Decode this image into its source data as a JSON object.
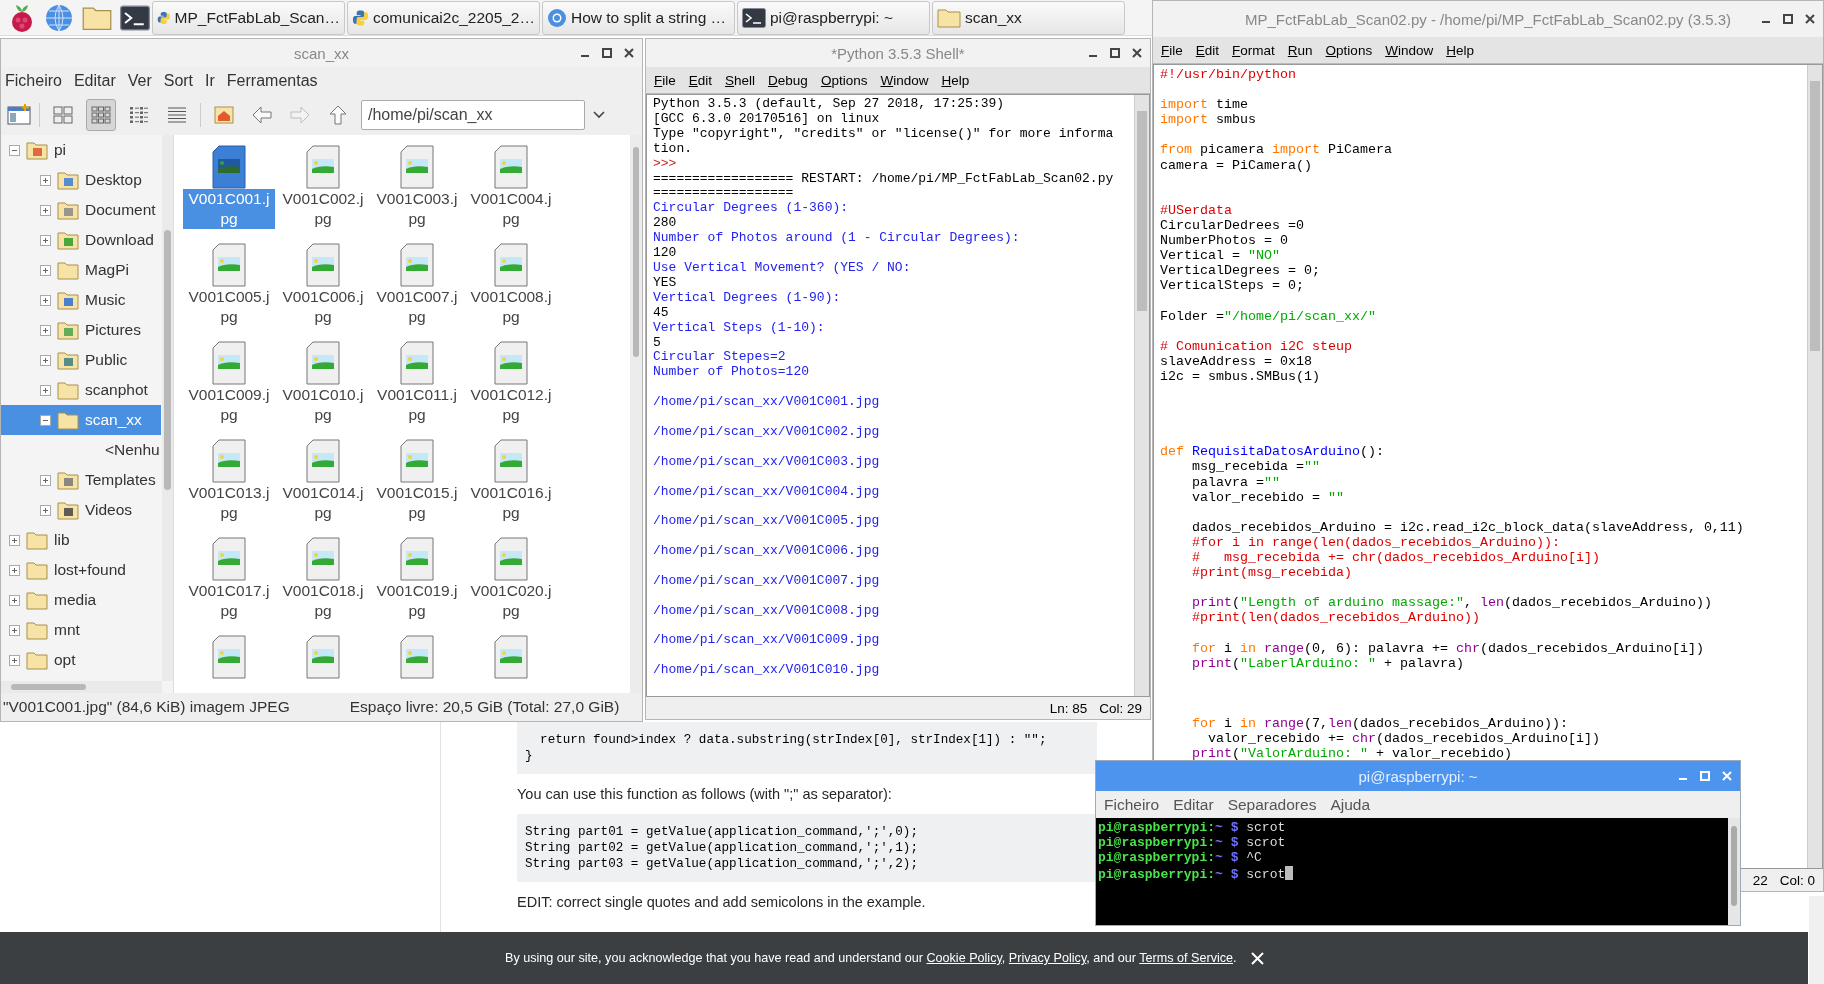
{
  "taskbar": {
    "tasks": [
      {
        "label": "MP_FctFabLab_Scan…",
        "kind": "python"
      },
      {
        "label": "comunicai2c_2205_2…",
        "kind": "python"
      },
      {
        "label": "How to split a string …",
        "kind": "chromium"
      },
      {
        "label": "pi@raspberrypi: ~",
        "kind": "terminal"
      },
      {
        "label": "scan_xx",
        "kind": "folder"
      }
    ]
  },
  "browser": {
    "code_1": [
      "  return found>index ? data.substring(strIndex[0], strIndex[1]) : \"\";",
      "}"
    ],
    "paragraph": "You can use this function as follows (with \";\" as separator):",
    "code_2": [
      "String part01 = getValue(application_command,';',0);",
      "String part02 = getValue(application_command,';',1);",
      "String part03 = getValue(application_command,';',2);"
    ],
    "edit_note": "EDIT: correct single quotes and add semicolons in the example."
  },
  "cookie_banner": {
    "segments": [
      {
        "kind": "text",
        "text": "By using our site, you acknowledge that you have read and understand our "
      },
      {
        "kind": "link",
        "text": "Cookie Policy"
      },
      {
        "kind": "text",
        "text": ", "
      },
      {
        "kind": "link",
        "text": "Privacy Policy"
      },
      {
        "kind": "text",
        "text": ", and our "
      },
      {
        "kind": "link",
        "text": "Terms of Service"
      },
      {
        "kind": "text",
        "text": "."
      }
    ]
  },
  "file_manager": {
    "title": "scan_xx",
    "menu": [
      "Ficheiro",
      "Editar",
      "Ver",
      "Sort",
      "Ir",
      "Ferramentas"
    ],
    "views": [
      {
        "kind": "thumbnail",
        "selected": false
      },
      {
        "kind": "icon",
        "selected": true
      },
      {
        "kind": "compact",
        "selected": false
      },
      {
        "kind": "list",
        "selected": false
      }
    ],
    "nav": [
      {
        "kind": "home",
        "disabled": false
      },
      {
        "kind": "back",
        "disabled": false
      },
      {
        "kind": "forward",
        "disabled": true
      },
      {
        "kind": "up",
        "disabled": false
      }
    ],
    "path": "/home/pi/scan_xx",
    "tree": [
      {
        "label": "pi",
        "kind": "home",
        "expanded": true,
        "selected": false,
        "children": [
          {
            "label": "Desktop",
            "kind": "desktop",
            "expanded": false,
            "selected": false
          },
          {
            "label": "Document",
            "kind": "documents",
            "expanded": false,
            "selected": false
          },
          {
            "label": "Download",
            "kind": "download",
            "expanded": false,
            "selected": false
          },
          {
            "label": "MagPi",
            "kind": "plain",
            "expanded": false,
            "selected": false
          },
          {
            "label": "Music",
            "kind": "music",
            "expanded": false,
            "selected": false
          },
          {
            "label": "Pictures",
            "kind": "pictures",
            "expanded": false,
            "selected": false
          },
          {
            "label": "Public",
            "kind": "public",
            "expanded": false,
            "selected": false
          },
          {
            "label": "scanphot",
            "kind": "plain",
            "expanded": false,
            "selected": false
          },
          {
            "label": "scan_xx",
            "kind": "plain",
            "expanded": true,
            "selected": true,
            "children": [
              {
                "label": "<Nenhu",
                "kind": "placeholder",
                "selected": false
              }
            ]
          },
          {
            "label": "Templates",
            "kind": "templates",
            "expanded": false,
            "selected": false
          },
          {
            "label": "Videos",
            "kind": "videos",
            "expanded": false,
            "selected": false
          }
        ]
      },
      {
        "label": "lib",
        "kind": "plain",
        "expanded": false,
        "selected": false
      },
      {
        "label": "lost+found",
        "kind": "plain",
        "expanded": false,
        "selected": false
      },
      {
        "label": "media",
        "kind": "plain",
        "expanded": false,
        "selected": false
      },
      {
        "label": "mnt",
        "kind": "plain",
        "expanded": false,
        "selected": false
      },
      {
        "label": "opt",
        "kind": "plain",
        "expanded": false,
        "selected": false
      }
    ],
    "files": [
      {
        "name": "V001C001.jpg",
        "selected": true
      },
      {
        "name": "V001C002.jpg",
        "selected": false
      },
      {
        "name": "V001C003.jpg",
        "selected": false
      },
      {
        "name": "V001C004.jpg",
        "selected": false
      },
      {
        "name": "V001C005.jpg",
        "selected": false
      },
      {
        "name": "V001C006.jpg",
        "selected": false
      },
      {
        "name": "V001C007.jpg",
        "selected": false
      },
      {
        "name": "V001C008.jpg",
        "selected": false
      },
      {
        "name": "V001C009.jpg",
        "selected": false
      },
      {
        "name": "V001C010.jpg",
        "selected": false
      },
      {
        "name": "V001C011.jpg",
        "selected": false
      },
      {
        "name": "V001C012.jpg",
        "selected": false
      },
      {
        "name": "V001C013.jpg",
        "selected": false
      },
      {
        "name": "V001C014.jpg",
        "selected": false
      },
      {
        "name": "V001C015.jpg",
        "selected": false
      },
      {
        "name": "V001C016.jpg",
        "selected": false
      },
      {
        "name": "V001C017.jpg",
        "selected": false
      },
      {
        "name": "V001C018.jpg",
        "selected": false
      },
      {
        "name": "V001C019.jpg",
        "selected": false
      },
      {
        "name": "V001C020.jpg",
        "selected": false
      },
      {
        "selected": false
      },
      {
        "selected": false
      },
      {
        "selected": false
      },
      {
        "selected": false
      }
    ],
    "status_selection": "\"V001C001.jpg\" (84,6 KiB) imagem JPEG",
    "status_free": "Espaço livre: 20,5 GiB (Total: 27,0 GiB)"
  },
  "shell": {
    "title": "*Python 3.5.3 Shell*",
    "menu": [
      "File",
      "Edit",
      "Shell",
      "Debug",
      "Options",
      "Window",
      "Help"
    ],
    "lines": [
      {
        "kind": "normal",
        "text": "Python 3.5.3 (default, Sep 27 2018, 17:25:39)"
      },
      {
        "kind": "normal",
        "text": "[GCC 6.3.0 20170516] on linux"
      },
      {
        "kind": "normal",
        "text": "Type \"copyright\", \"credits\" or \"license()\" for more informa"
      },
      {
        "kind": "normal",
        "text": "tion."
      },
      {
        "kind": "prompt",
        "text": ">>>"
      },
      {
        "kind": "normal",
        "text": "================== RESTART: /home/pi/MP_FctFabLab_Scan02.py"
      },
      {
        "kind": "normal",
        "text": "=================="
      },
      {
        "kind": "output",
        "text": "Circular Degrees (1-360):"
      },
      {
        "kind": "normal",
        "text": "280"
      },
      {
        "kind": "output",
        "text": "Number of Photos around (1 - Circular Degrees):"
      },
      {
        "kind": "normal",
        "text": "120"
      },
      {
        "kind": "output",
        "text": "Use Vertical Movement? (YES / NO:"
      },
      {
        "kind": "normal",
        "text": "YES"
      },
      {
        "kind": "output",
        "text": "Vertical Degrees (1-90):"
      },
      {
        "kind": "normal",
        "text": "45"
      },
      {
        "kind": "output",
        "text": "Vertical Steps (1-10):"
      },
      {
        "kind": "normal",
        "text": "5"
      },
      {
        "kind": "output",
        "text": "Circular Stepes=2"
      },
      {
        "kind": "output",
        "text": "Number of Photos=120"
      },
      {
        "kind": "path",
        "text": "/home/pi/scan_xx/V001C001.jpg"
      },
      {
        "kind": "path",
        "text": "/home/pi/scan_xx/V001C002.jpg"
      },
      {
        "kind": "path",
        "text": "/home/pi/scan_xx/V001C003.jpg"
      },
      {
        "kind": "path",
        "text": "/home/pi/scan_xx/V001C004.jpg"
      },
      {
        "kind": "path",
        "text": "/home/pi/scan_xx/V001C005.jpg"
      },
      {
        "kind": "path",
        "text": "/home/pi/scan_xx/V001C006.jpg"
      },
      {
        "kind": "path",
        "text": "/home/pi/scan_xx/V001C007.jpg"
      },
      {
        "kind": "path",
        "text": "/home/pi/scan_xx/V001C008.jpg"
      },
      {
        "kind": "path",
        "text": "/home/pi/scan_xx/V001C009.jpg"
      },
      {
        "kind": "path",
        "text": "/home/pi/scan_xx/V001C010.jpg"
      }
    ],
    "status_ln": "Ln: 85",
    "status_col": "Col: 29"
  },
  "editor": {
    "title": "MP_FctFabLab_Scan02.py - /home/pi/MP_FctFabLab_Scan02.py (3.5.3)",
    "menu": [
      "File",
      "Edit",
      "Format",
      "Run",
      "Options",
      "Window",
      "Help"
    ],
    "blocks": [
      {
        "kind": "none",
        "lines": [
          [
            {
              "text": "#!/usr/bin/python",
              "kind": "comment"
            }
          ]
        ]
      },
      {
        "kind": "one",
        "lines": [
          [
            {
              "text": "import",
              "kind": "keyword"
            },
            {
              "text": " time",
              "kind": "plain"
            }
          ],
          [
            {
              "text": "import",
              "kind": "keyword"
            },
            {
              "text": " smbus",
              "kind": "plain"
            }
          ]
        ]
      },
      {
        "kind": "one",
        "lines": [
          [
            {
              "text": "from",
              "kind": "keyword"
            },
            {
              "text": " picamera ",
              "kind": "plain"
            },
            {
              "text": "import",
              "kind": "keyword"
            },
            {
              "text": " PiCamera",
              "kind": "plain"
            }
          ],
          [
            {
              "text": "camera = PiCamera()",
              "kind": "plain"
            }
          ]
        ]
      },
      {
        "kind": "two",
        "lines": [
          [
            {
              "text": "#USerdata",
              "kind": "comment"
            }
          ],
          [
            {
              "text": "CircularDedrees =0",
              "kind": "plain"
            }
          ],
          [
            {
              "text": "NumberPhotos = 0",
              "kind": "plain"
            }
          ],
          [
            {
              "text": "Vertical = ",
              "kind": "plain"
            },
            {
              "text": "\"NO\"",
              "kind": "string"
            }
          ],
          [
            {
              "text": "VerticalDegrees = 0;",
              "kind": "plain"
            }
          ],
          [
            {
              "text": "VerticalSteps = 0;",
              "kind": "plain"
            }
          ]
        ]
      },
      {
        "kind": "one",
        "lines": [
          [
            {
              "text": "Folder =",
              "kind": "plain"
            },
            {
              "text": "\"/home/pi/scan_xx/\"",
              "kind": "string"
            }
          ]
        ]
      },
      {
        "kind": "one",
        "lines": [
          [
            {
              "text": "# Comunication i2C steup",
              "kind": "comment"
            }
          ],
          [
            {
              "text": "slaveAddress = 0x18",
              "kind": "plain"
            }
          ],
          [
            {
              "text": "i2c = smbus.SMBus(1)",
              "kind": "plain"
            }
          ]
        ]
      },
      {
        "kind": "four",
        "lines": [
          [
            {
              "text": "def ",
              "kind": "keyword"
            },
            {
              "text": "RequisitaDatosArduino",
              "kind": "def"
            },
            {
              "text": "():",
              "kind": "plain"
            }
          ],
          [
            {
              "text": "    msg_recebida =",
              "kind": "plain"
            },
            {
              "text": "\"\"",
              "kind": "string"
            }
          ],
          [
            {
              "text": "    palavra =",
              "kind": "plain"
            },
            {
              "text": "\"\"",
              "kind": "string"
            }
          ],
          [
            {
              "text": "    valor_recebido = ",
              "kind": "plain"
            },
            {
              "text": "\"\"",
              "kind": "string"
            }
          ]
        ]
      },
      {
        "kind": "one",
        "lines": [
          [
            {
              "text": "    dados_recebidos_Arduino = i2c.read_i2c_block_data(slaveAddress, 0,11)",
              "kind": "plain"
            }
          ],
          [
            {
              "text": "    #for i in range(len(dados_recebidos_Arduino)):",
              "kind": "comment"
            }
          ],
          [
            {
              "text": "    #   msg_recebida += chr(dados_recebidos_Arduino[i])",
              "kind": "comment"
            }
          ],
          [
            {
              "text": "    #print(msg_recebida)",
              "kind": "comment"
            }
          ]
        ]
      },
      {
        "kind": "one",
        "lines": [
          [
            {
              "text": "    print",
              "kind": "builtin"
            },
            {
              "text": "(",
              "kind": "plain"
            },
            {
              "text": "\"Length of arduino massage:\"",
              "kind": "string"
            },
            {
              "text": ", ",
              "kind": "plain"
            },
            {
              "text": "len",
              "kind": "builtin"
            },
            {
              "text": "(dados_recebidos_Arduino))",
              "kind": "plain"
            }
          ],
          [
            {
              "text": "    #print(len(dados_recebidos_Arduino))",
              "kind": "comment"
            }
          ]
        ]
      },
      {
        "kind": "one",
        "lines": [
          [
            {
              "text": "    for",
              "kind": "keyword"
            },
            {
              "text": " i ",
              "kind": "plain"
            },
            {
              "text": "in ",
              "kind": "keyword"
            },
            {
              "text": "range",
              "kind": "builtin"
            },
            {
              "text": "(0, 6): palavra += ",
              "kind": "plain"
            },
            {
              "text": "chr",
              "kind": "builtin"
            },
            {
              "text": "(dados_recebidos_Arduino[i])",
              "kind": "plain"
            }
          ],
          [
            {
              "text": "    print",
              "kind": "builtin"
            },
            {
              "text": "(",
              "kind": "plain"
            },
            {
              "text": "\"LaberlArduino: \"",
              "kind": "string"
            },
            {
              "text": " + palavra)",
              "kind": "plain"
            }
          ]
        ]
      },
      {
        "kind": "three",
        "lines": [
          [
            {
              "text": "    for",
              "kind": "keyword"
            },
            {
              "text": " i ",
              "kind": "plain"
            },
            {
              "text": "in ",
              "kind": "keyword"
            },
            {
              "text": "range",
              "kind": "builtin"
            },
            {
              "text": "(7,",
              "kind": "plain"
            },
            {
              "text": "len",
              "kind": "builtin"
            },
            {
              "text": "(dados_recebidos_Arduino)):",
              "kind": "plain"
            }
          ],
          [
            {
              "text": "      valor_recebido += ",
              "kind": "plain"
            },
            {
              "text": "chr",
              "kind": "builtin"
            },
            {
              "text": "(dados_recebidos_Arduino[i])",
              "kind": "plain"
            }
          ],
          [
            {
              "text": "    print",
              "kind": "builtin"
            },
            {
              "text": "(",
              "kind": "plain"
            },
            {
              "text": "\"ValorArduino: \"",
              "kind": "string"
            },
            {
              "text": " + valor_recebido)",
              "kind": "plain"
            }
          ]
        ]
      }
    ],
    "status_ln": "22",
    "status_col": "Col: 0"
  },
  "terminal": {
    "title": "pi@raspberrypi: ~",
    "menu": [
      "Ficheiro",
      "Editar",
      "Separadores",
      "Ajuda"
    ],
    "lines": [
      {
        "user_host": "pi@raspberrypi:",
        "path": "~ $",
        "command": "scrot",
        "cursor": false
      },
      {
        "user_host": "pi@raspberrypi:",
        "path": "~ $",
        "command": "scrot",
        "cursor": false
      },
      {
        "user_host": "pi@raspberrypi:",
        "path": "~ $",
        "command": "^C",
        "cursor": false
      },
      {
        "user_host": "pi@raspberrypi:",
        "path": "~ $",
        "command": "scrot",
        "cursor": true
      }
    ]
  }
}
